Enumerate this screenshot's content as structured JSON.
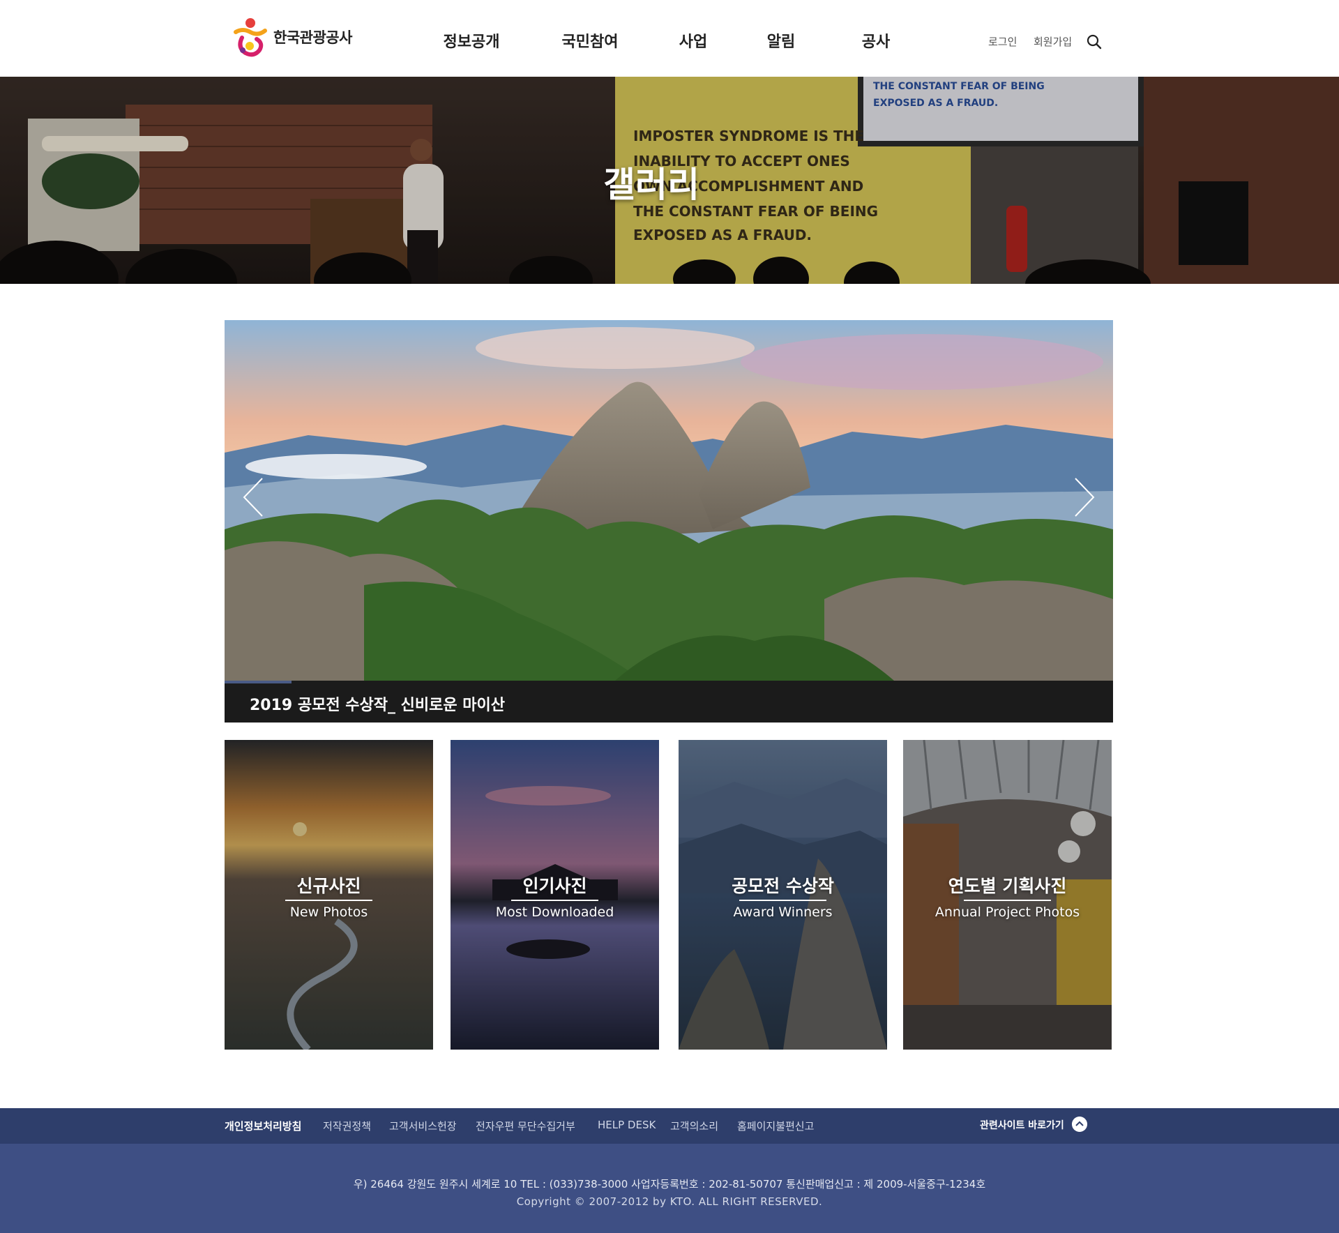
{
  "header": {
    "logo_text": "한국관광공사",
    "nav": [
      "정보공개",
      "국민참여",
      "사업",
      "알림",
      "공사"
    ],
    "login": "로그인",
    "signup": "회원가입",
    "search_icon": "search-icon"
  },
  "banner": {
    "title": "갤러리",
    "screen_text": [
      "IMPOSTER SYNDROME IS THE",
      "INABILITY TO ACCEPT ONES",
      "OWN ACCOMPLISHMENT AND",
      "THE CONSTANT FEAR OF BEING",
      "EXPOSED AS A FRAUD."
    ],
    "tv_text": [
      "THE CONSTANT FEAR OF BEING",
      "EXPOSED AS A FRAUD."
    ]
  },
  "slider": {
    "caption": "2019 공모전 수상작_ 신비로운 마이산",
    "progress_fraction": 0.075,
    "prev_icon": "chevron-left-icon",
    "next_icon": "chevron-right-icon"
  },
  "categories": [
    {
      "title": "신규사진",
      "subtitle": "New Photos"
    },
    {
      "title": "인기사진",
      "subtitle": "Most Downloaded"
    },
    {
      "title": "공모전 수상작",
      "subtitle": "Award Winners"
    },
    {
      "title": "연도별 기획사진",
      "subtitle": "Annual Project Photos"
    }
  ],
  "footer": {
    "links": [
      "개인정보처리방침",
      "저작권정책",
      "고객서비스헌장",
      "전자우편 무단수집거부",
      "HELP DESK",
      "고객의소리",
      "홈페이지불편신고"
    ],
    "family_site": "관련사이트 바로가기",
    "family_icon": "chevron-up-icon",
    "address": "우) 26464 강원도 원주시 세계로 10 TEL : (033)738-3000 사업자등록번호 : 202-81-50707 통신판매업신고 : 제 2009-서울중구-1234호",
    "copyright": "Copyright © 2007-2012 by KTO. ALL RIGHT RESERVED."
  },
  "colors": {
    "footer_top": "#2e3e6b",
    "footer_bottom": "#3e4f84",
    "progress": "#4a5b86",
    "caption_bar": "#1b1b1b"
  }
}
